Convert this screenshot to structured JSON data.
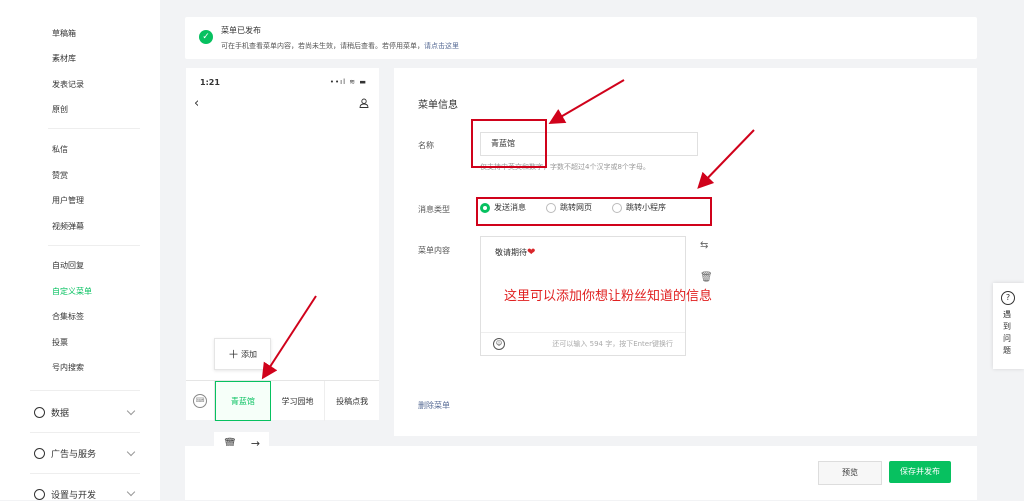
{
  "sidebar": {
    "items_group1": [
      "草稿箱",
      "素材库",
      "发表记录",
      "原创"
    ],
    "items_group2": [
      "私信",
      "赞赏",
      "用户管理",
      "视频弹幕"
    ],
    "items_group3": [
      "自动回复",
      "自定义菜单",
      "合集标签",
      "投票",
      "号内搜索"
    ],
    "main": [
      {
        "label": "数据",
        "icon": "chart-icon"
      },
      {
        "label": "广告与服务",
        "icon": "compass-icon"
      },
      {
        "label": "设置与开发",
        "icon": "gear-icon"
      }
    ]
  },
  "notice": {
    "title": "菜单已发布",
    "desc": "可在手机查看菜单内容，若尚未生效，请稍后查看。若停用菜单，",
    "link": "请点击这里"
  },
  "phone": {
    "time": "1:21",
    "status": "••ıl ≋ ▬",
    "add_label": "添加",
    "tabs": [
      "青蓝馆",
      "学习园地",
      "投稿点我"
    ],
    "selected_tab": 0
  },
  "panel": {
    "title": "菜单信息",
    "name_label": "名称",
    "name_value": "青蓝馆",
    "name_hint": "仅支持中英文和数字，字数不超过4个汉字或8个字母。",
    "type_label": "消息类型",
    "types": [
      "发送消息",
      "跳转网页",
      "跳转小程序"
    ],
    "selected_type": 0,
    "content_label": "菜单内容",
    "content_text": "敬请期待",
    "content_count": "还可以输入 594 字，按下Enter键换行",
    "delete_label": "删除菜单"
  },
  "annotation": "这里可以添加你想让粉丝知道的信息",
  "footer": {
    "preview_label": "预览",
    "save_label": "保存并发布"
  },
  "help": {
    "label": "遇到问题"
  },
  "colors": {
    "accent": "#07c160",
    "annotation": "#d0021b",
    "link": "#576b95"
  }
}
